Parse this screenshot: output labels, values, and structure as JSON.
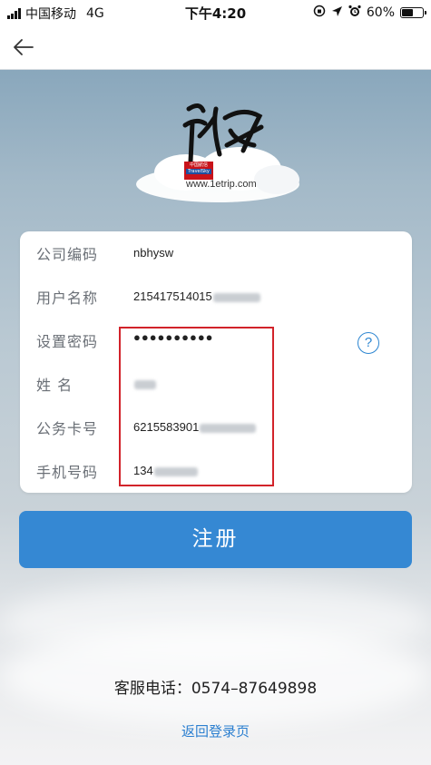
{
  "status_bar": {
    "carrier": "中国移动",
    "network": "4G",
    "time": "下午4:20",
    "battery": "60%",
    "battery_level": 0.6
  },
  "logo": {
    "badge_cn": "中国航信",
    "badge_en": "TravelSky",
    "url": "www.1etrip.com"
  },
  "form": {
    "fields": [
      {
        "label": "公司编码",
        "value": "nbhysw"
      },
      {
        "label": "用户名称",
        "value": "215417514015"
      },
      {
        "label": "设置密码",
        "value": "●●●●●●●●●●"
      },
      {
        "label": "姓 名",
        "value": ""
      },
      {
        "label": "公务卡号",
        "value": "6215583901"
      },
      {
        "label": "手机号码",
        "value": "134"
      }
    ],
    "help_icon": "?"
  },
  "register_button": "注册",
  "hotline": "客服电话：0574–87649898",
  "back_to_login": "返回登录页",
  "colors": {
    "accent": "#3588d3",
    "highlight_border": "#d2232a",
    "link": "#2b7fd0"
  }
}
